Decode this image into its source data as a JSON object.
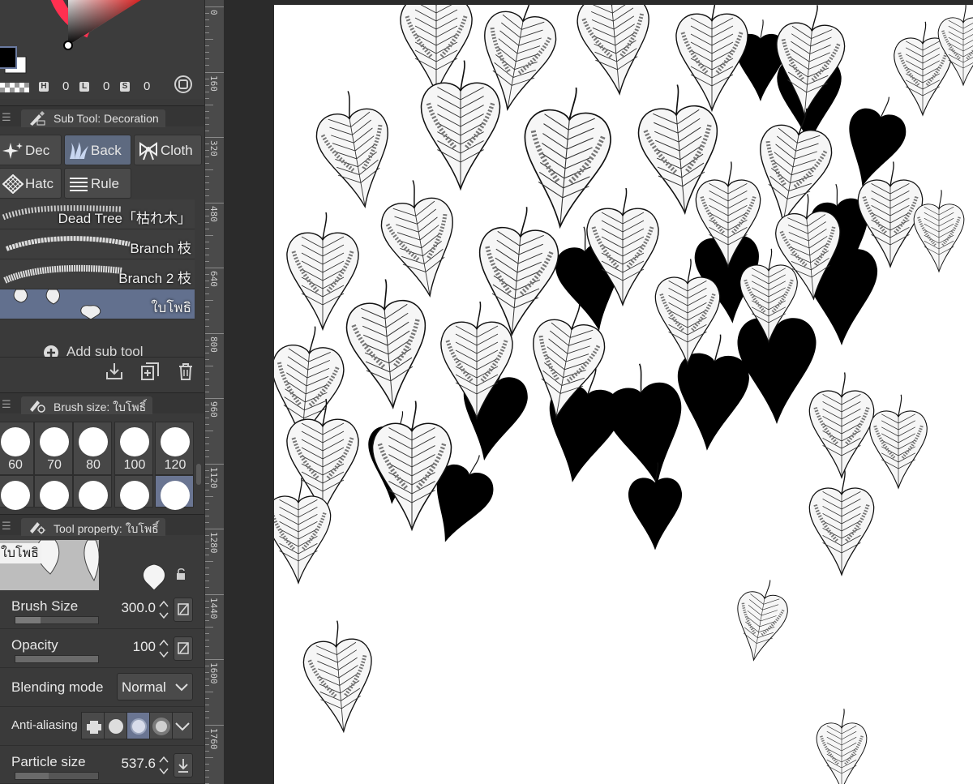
{
  "colors": {
    "accent": "#62708e",
    "panel": "#3a3a3a",
    "main_color": "#000000",
    "sub_color": "#ffffff"
  },
  "color_panel": {
    "hsv": [
      {
        "key": "H",
        "value": "0"
      },
      {
        "key": "L",
        "value": "0"
      },
      {
        "key": "S",
        "value": "0"
      }
    ]
  },
  "sub_tool": {
    "tab_label": "Sub Tool: Decoration",
    "groups": [
      {
        "label": "Dec",
        "icon": "sparkle-icon",
        "active": false
      },
      {
        "label": "Back",
        "icon": "grass-icon",
        "active": true
      },
      {
        "label": "Cloth",
        "icon": "ribbon-icon",
        "active": false
      },
      {
        "label": "Hatc",
        "icon": "hatching-icon",
        "active": false
      },
      {
        "label": "Rule",
        "icon": "ruled-lines-icon",
        "active": false
      }
    ],
    "brushes": [
      {
        "label": "Dead Tree「枯れ木」",
        "active": false
      },
      {
        "label": "Branch 枝",
        "active": false
      },
      {
        "label": "Branch 2  枝",
        "active": false
      },
      {
        "label": "ใบโพธิ",
        "active": true
      }
    ],
    "add_label": "Add sub tool"
  },
  "brush_size": {
    "tab_label": "Brush size: ใบโพธิ์",
    "sizes": [
      "60",
      "70",
      "80",
      "100",
      "120"
    ]
  },
  "tool_property": {
    "tab_label": "Tool property: ใบโพธิ์",
    "preview_label": "ใบโพธิ",
    "brush_size_label": "Brush Size",
    "brush_size_value": "300.0",
    "brush_size_fill": 0.3,
    "opacity_label": "Opacity",
    "opacity_value": "100",
    "opacity_fill": 1.0,
    "blending_label": "Blending mode",
    "blending_value": "Normal",
    "antialias_label": "Anti-aliasing",
    "particle_label": "Particle size",
    "particle_value": "537.6"
  },
  "ruler": {
    "labels": [
      "0",
      "160",
      "320",
      "480",
      "640",
      "800",
      "960",
      "1120",
      "1280",
      "1440",
      "1600",
      "1760"
    ]
  }
}
